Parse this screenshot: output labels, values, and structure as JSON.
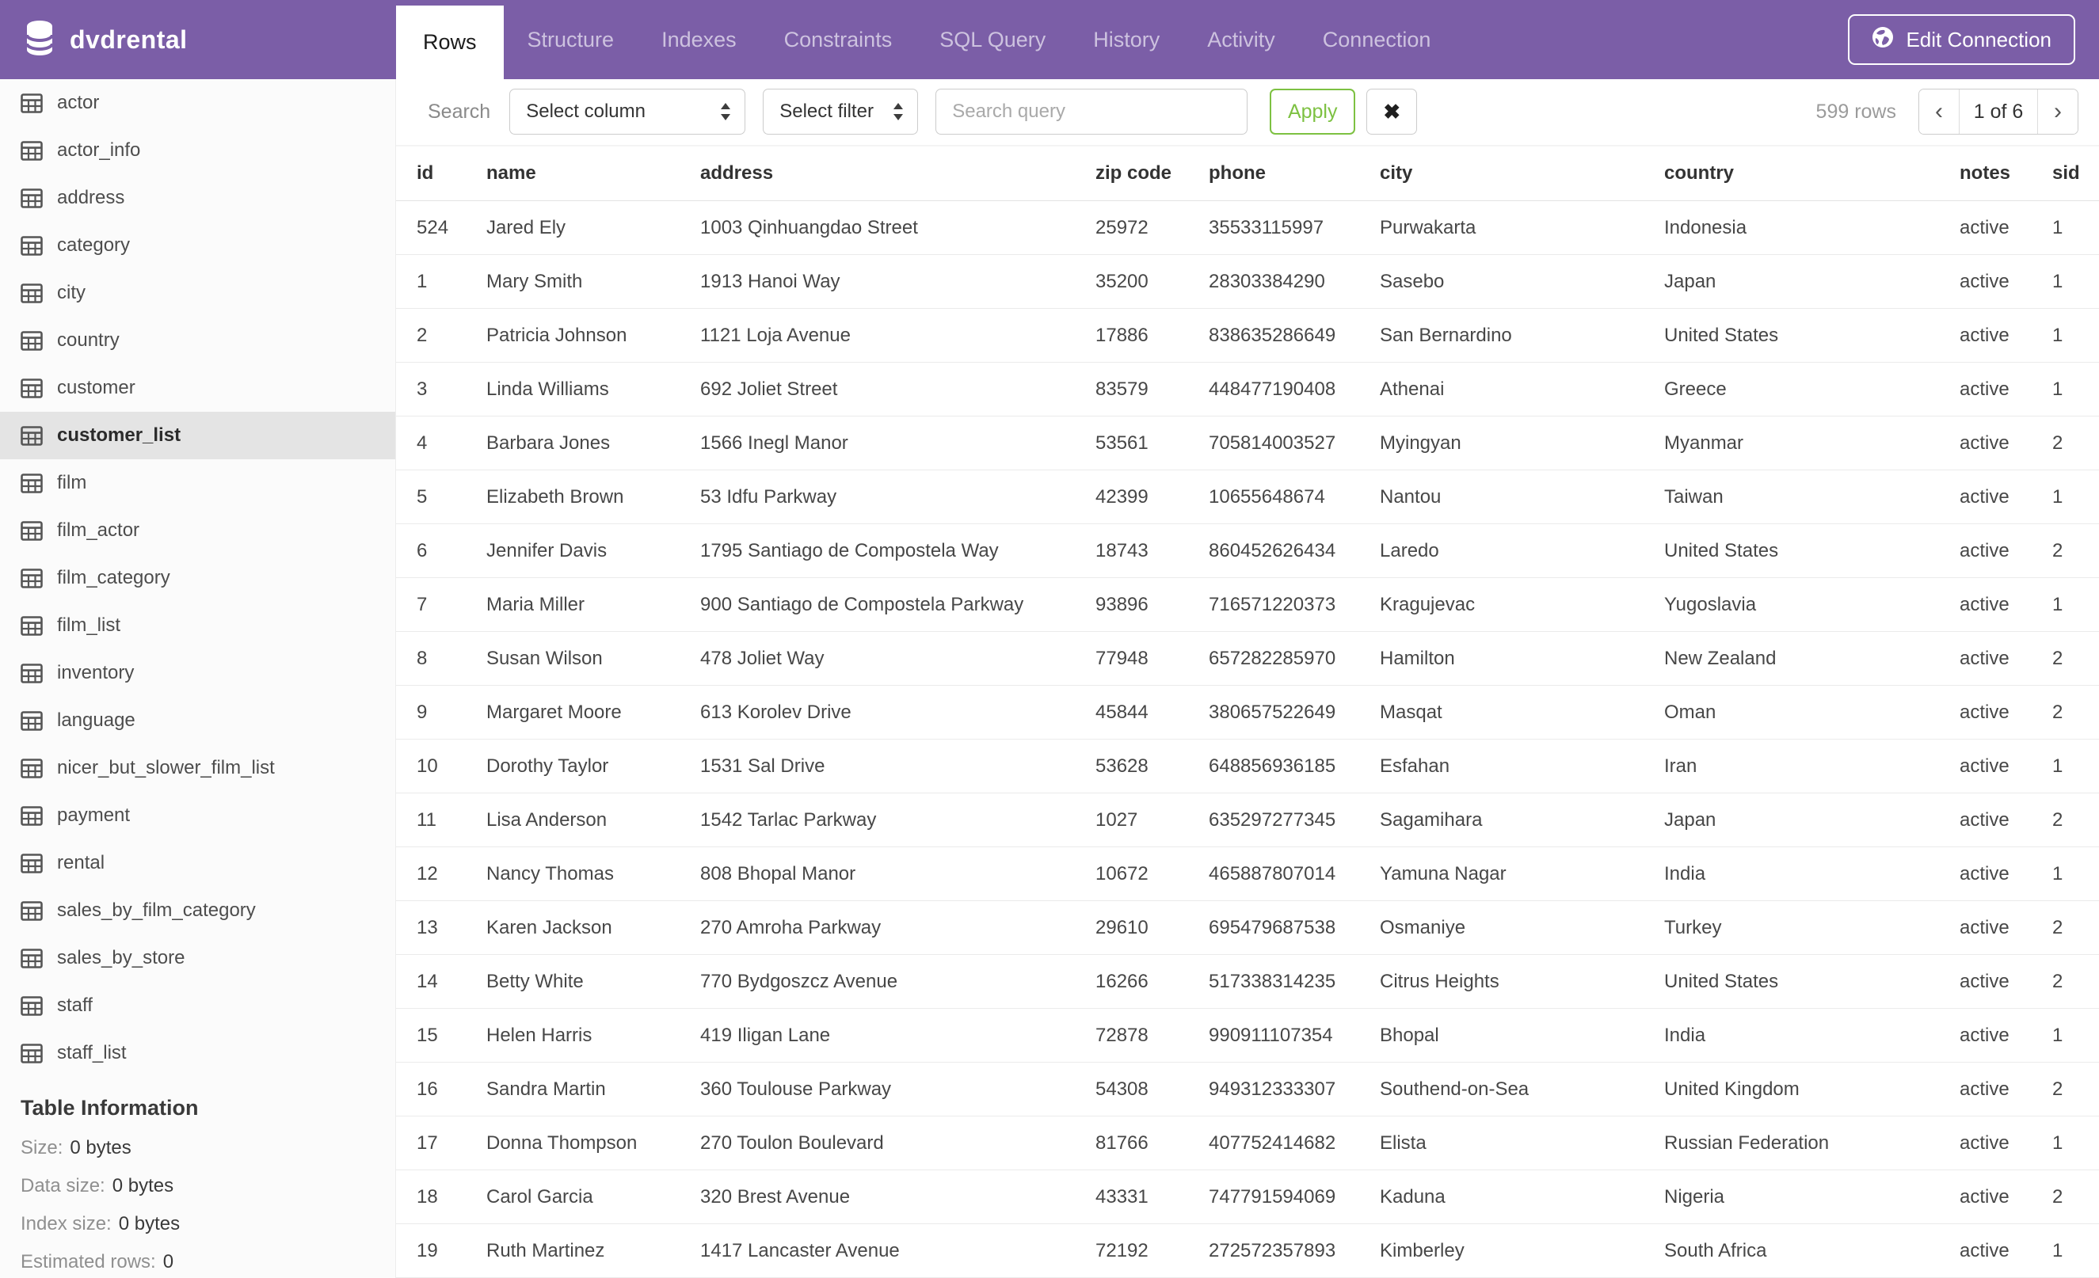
{
  "header": {
    "database_name": "dvdrental",
    "tabs": [
      {
        "label": "Rows",
        "active": true
      },
      {
        "label": "Structure",
        "active": false
      },
      {
        "label": "Indexes",
        "active": false
      },
      {
        "label": "Constraints",
        "active": false
      },
      {
        "label": "SQL Query",
        "active": false
      },
      {
        "label": "History",
        "active": false
      },
      {
        "label": "Activity",
        "active": false
      },
      {
        "label": "Connection",
        "active": false
      }
    ],
    "edit_connection_label": "Edit Connection",
    "accent_color": "#7B5EA7"
  },
  "sidebar": {
    "tables": [
      "actor",
      "actor_info",
      "address",
      "category",
      "city",
      "country",
      "customer",
      "customer_list",
      "film",
      "film_actor",
      "film_category",
      "film_list",
      "inventory",
      "language",
      "nicer_but_slower_film_list",
      "payment",
      "rental",
      "sales_by_film_category",
      "sales_by_store",
      "staff",
      "staff_list"
    ],
    "selected_table": "customer_list",
    "table_information": {
      "heading": "Table Information",
      "items": [
        {
          "label": "Size:",
          "value": "0 bytes"
        },
        {
          "label": "Data size:",
          "value": "0 bytes"
        },
        {
          "label": "Index size:",
          "value": "0 bytes"
        },
        {
          "label": "Estimated rows:",
          "value": "0"
        }
      ]
    }
  },
  "toolbar": {
    "search_label": "Search",
    "column_select_value": "Select column",
    "filter_select_value": "Select filter",
    "query_placeholder": "Search query",
    "apply_label": "Apply",
    "clear_label": "✖",
    "rows_count": "599 rows",
    "apply_color": "#7DC142",
    "pagination": {
      "prev": "‹",
      "current": "1 of 6",
      "next": "›"
    }
  },
  "table": {
    "columns": [
      "id",
      "name",
      "address",
      "zip code",
      "phone",
      "city",
      "country",
      "notes",
      "sid"
    ],
    "rows": [
      [
        "524",
        "Jared Ely",
        "1003 Qinhuangdao Street",
        "25972",
        "35533115997",
        "Purwakarta",
        "Indonesia",
        "active",
        "1"
      ],
      [
        "1",
        "Mary Smith",
        "1913 Hanoi Way",
        "35200",
        "28303384290",
        "Sasebo",
        "Japan",
        "active",
        "1"
      ],
      [
        "2",
        "Patricia Johnson",
        "1121 Loja Avenue",
        "17886",
        "838635286649",
        "San Bernardino",
        "United States",
        "active",
        "1"
      ],
      [
        "3",
        "Linda Williams",
        "692 Joliet Street",
        "83579",
        "448477190408",
        "Athenai",
        "Greece",
        "active",
        "1"
      ],
      [
        "4",
        "Barbara Jones",
        "1566 Inegl Manor",
        "53561",
        "705814003527",
        "Myingyan",
        "Myanmar",
        "active",
        "2"
      ],
      [
        "5",
        "Elizabeth Brown",
        "53 Idfu Parkway",
        "42399",
        "10655648674",
        "Nantou",
        "Taiwan",
        "active",
        "1"
      ],
      [
        "6",
        "Jennifer Davis",
        "1795 Santiago de Compostela Way",
        "18743",
        "860452626434",
        "Laredo",
        "United States",
        "active",
        "2"
      ],
      [
        "7",
        "Maria Miller",
        "900 Santiago de Compostela Parkway",
        "93896",
        "716571220373",
        "Kragujevac",
        "Yugoslavia",
        "active",
        "1"
      ],
      [
        "8",
        "Susan Wilson",
        "478 Joliet Way",
        "77948",
        "657282285970",
        "Hamilton",
        "New Zealand",
        "active",
        "2"
      ],
      [
        "9",
        "Margaret Moore",
        "613 Korolev Drive",
        "45844",
        "380657522649",
        "Masqat",
        "Oman",
        "active",
        "2"
      ],
      [
        "10",
        "Dorothy Taylor",
        "1531 Sal Drive",
        "53628",
        "648856936185",
        "Esfahan",
        "Iran",
        "active",
        "1"
      ],
      [
        "11",
        "Lisa Anderson",
        "1542 Tarlac Parkway",
        "1027",
        "635297277345",
        "Sagamihara",
        "Japan",
        "active",
        "2"
      ],
      [
        "12",
        "Nancy Thomas",
        "808 Bhopal Manor",
        "10672",
        "465887807014",
        "Yamuna Nagar",
        "India",
        "active",
        "1"
      ],
      [
        "13",
        "Karen Jackson",
        "270 Amroha Parkway",
        "29610",
        "695479687538",
        "Osmaniye",
        "Turkey",
        "active",
        "2"
      ],
      [
        "14",
        "Betty White",
        "770 Bydgoszcz Avenue",
        "16266",
        "517338314235",
        "Citrus Heights",
        "United States",
        "active",
        "2"
      ],
      [
        "15",
        "Helen Harris",
        "419 Iligan Lane",
        "72878",
        "990911107354",
        "Bhopal",
        "India",
        "active",
        "1"
      ],
      [
        "16",
        "Sandra Martin",
        "360 Toulouse Parkway",
        "54308",
        "949312333307",
        "Southend-on-Sea",
        "United Kingdom",
        "active",
        "2"
      ],
      [
        "17",
        "Donna Thompson",
        "270 Toulon Boulevard",
        "81766",
        "407752414682",
        "Elista",
        "Russian Federation",
        "active",
        "1"
      ],
      [
        "18",
        "Carol Garcia",
        "320 Brest Avenue",
        "43331",
        "747791594069",
        "Kaduna",
        "Nigeria",
        "active",
        "2"
      ],
      [
        "19",
        "Ruth Martinez",
        "1417 Lancaster Avenue",
        "72192",
        "272572357893",
        "Kimberley",
        "South Africa",
        "active",
        "1"
      ]
    ]
  }
}
